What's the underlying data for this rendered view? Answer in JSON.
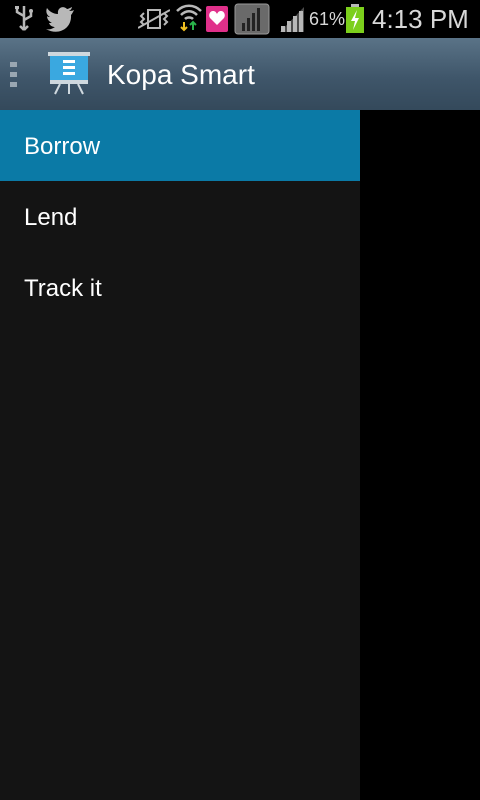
{
  "status_bar": {
    "icons": [
      "usb-icon",
      "twitter-icon",
      "vibrate-icon",
      "wifi-icon",
      "health-app-icon",
      "signal-box-icon",
      "signal-icon",
      "battery-charging-icon"
    ],
    "battery_percent": "61%",
    "time": "4:13 PM"
  },
  "action_bar": {
    "title": "Kopa Smart",
    "icon": "presentation-board-icon"
  },
  "drawer": {
    "items": [
      {
        "label": "Borrow",
        "selected": true
      },
      {
        "label": "Lend",
        "selected": false
      },
      {
        "label": "Track it",
        "selected": false
      }
    ]
  },
  "colors": {
    "selected_item": "#0b7aa6",
    "drawer_bg": "#141414",
    "action_bar": "#3f566a"
  }
}
